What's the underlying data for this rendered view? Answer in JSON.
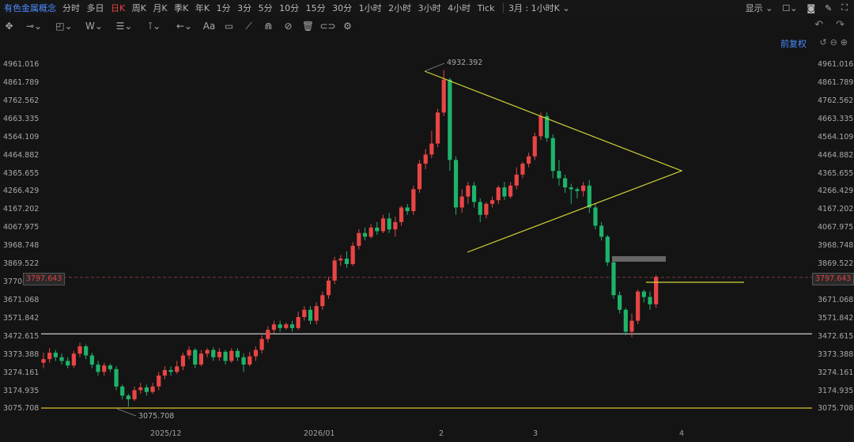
{
  "header": {
    "symbol": "有色金属概念",
    "periods": [
      "分时",
      "多日",
      "日K",
      "周K",
      "月K",
      "季K",
      "年K",
      "1分",
      "3分",
      "5分",
      "10分",
      "15分",
      "30分",
      "1小时",
      "2小时",
      "3小时",
      "4小时",
      "Tick"
    ],
    "active_period": "日K",
    "custom_period": "3月 : 1小时K ⌄",
    "display_label": "显示 ⌄"
  },
  "toolbar": {
    "icons": [
      "move-icon",
      "line-tool-icon",
      "shape-tool-icon",
      "wave-tool-icon",
      "fib-tool-icon",
      "measure-tool-icon",
      "arrow-tool-icon",
      "text-tool-icon",
      "note-tool-icon",
      "brush-icon",
      "magnet-icon",
      "eye-off-icon",
      "trash-icon",
      "link-icon",
      "settings-icon"
    ],
    "text_tool_label": "Aa"
  },
  "adjust": {
    "label": "前复权"
  },
  "axis": {
    "y_ticks": [
      "4961.016",
      "4861.789",
      "4762.562",
      "4663.335",
      "4564.109",
      "4464.882",
      "4365.655",
      "4266.429",
      "4167.202",
      "4067.975",
      "3968.748",
      "3869.522",
      "3770.295",
      "3671.068",
      "3571.842",
      "3472.615",
      "3373.388",
      "3274.161",
      "3174.935",
      "3075.708"
    ],
    "current_price": "3797.643",
    "current_price_left": "3797.643",
    "x_ticks": [
      "2025/12",
      "2026/01",
      "2",
      "3",
      "4"
    ]
  },
  "annotations": {
    "high": "4932.392",
    "low": "3075.708"
  },
  "colors": {
    "up": "#e84545",
    "down": "#1fb36a",
    "triangle": "#d6d63a",
    "support": "#cccccc",
    "bottom": "#c8b030",
    "accent": "#4a8cff"
  },
  "chart_data": {
    "type": "candlestick",
    "ylim": [
      3040,
      5000
    ],
    "high_label": 4932.392,
    "low_label": 3075.708,
    "candles": [
      [
        3330,
        3350,
        3300,
        3385
      ],
      [
        3350,
        3385,
        3330,
        3410
      ],
      [
        3385,
        3360,
        3340,
        3400
      ],
      [
        3360,
        3340,
        3320,
        3380
      ],
      [
        3340,
        3315,
        3300,
        3360
      ],
      [
        3315,
        3380,
        3300,
        3395
      ],
      [
        3380,
        3420,
        3360,
        3440
      ],
      [
        3420,
        3370,
        3350,
        3430
      ],
      [
        3370,
        3320,
        3300,
        3385
      ],
      [
        3320,
        3280,
        3260,
        3340
      ],
      [
        3280,
        3315,
        3260,
        3330
      ],
      [
        3315,
        3295,
        3280,
        3325
      ],
      [
        3295,
        3200,
        3180,
        3310
      ],
      [
        3200,
        3150,
        3130,
        3210
      ],
      [
        3150,
        3130,
        3090,
        3160
      ],
      [
        3130,
        3180,
        3120,
        3200
      ],
      [
        3180,
        3195,
        3160,
        3220
      ],
      [
        3195,
        3170,
        3150,
        3210
      ],
      [
        3170,
        3200,
        3160,
        3220
      ],
      [
        3200,
        3260,
        3180,
        3280
      ],
      [
        3260,
        3290,
        3240,
        3310
      ],
      [
        3290,
        3280,
        3260,
        3310
      ],
      [
        3280,
        3310,
        3270,
        3340
      ],
      [
        3310,
        3370,
        3290,
        3385
      ],
      [
        3370,
        3400,
        3350,
        3420
      ],
      [
        3400,
        3320,
        3300,
        3410
      ],
      [
        3320,
        3380,
        3310,
        3400
      ],
      [
        3380,
        3400,
        3360,
        3410
      ],
      [
        3400,
        3360,
        3340,
        3415
      ],
      [
        3360,
        3390,
        3340,
        3410
      ],
      [
        3390,
        3340,
        3320,
        3400
      ],
      [
        3340,
        3395,
        3330,
        3410
      ],
      [
        3395,
        3360,
        3340,
        3410
      ],
      [
        3360,
        3320,
        3280,
        3380
      ],
      [
        3320,
        3365,
        3310,
        3390
      ],
      [
        3365,
        3400,
        3340,
        3420
      ],
      [
        3400,
        3460,
        3380,
        3480
      ],
      [
        3460,
        3510,
        3440,
        3530
      ],
      [
        3510,
        3540,
        3490,
        3560
      ],
      [
        3540,
        3520,
        3500,
        3560
      ],
      [
        3520,
        3540,
        3510,
        3550
      ],
      [
        3540,
        3520,
        3500,
        3560
      ],
      [
        3520,
        3580,
        3510,
        3610
      ],
      [
        3580,
        3620,
        3560,
        3640
      ],
      [
        3620,
        3560,
        3540,
        3640
      ],
      [
        3560,
        3640,
        3540,
        3660
      ],
      [
        3640,
        3700,
        3620,
        3720
      ],
      [
        3700,
        3780,
        3680,
        3800
      ],
      [
        3780,
        3890,
        3760,
        3910
      ],
      [
        3890,
        3900,
        3860,
        3920
      ],
      [
        3900,
        3870,
        3850,
        3940
      ],
      [
        3870,
        3970,
        3860,
        3990
      ],
      [
        3970,
        4040,
        3950,
        4060
      ],
      [
        4040,
        4020,
        4000,
        4070
      ],
      [
        4020,
        4070,
        4010,
        4090
      ],
      [
        4070,
        4050,
        4030,
        4100
      ],
      [
        4050,
        4120,
        4040,
        4140
      ],
      [
        4120,
        4060,
        4040,
        4150
      ],
      [
        4060,
        4100,
        4020,
        4130
      ],
      [
        4100,
        4180,
        4080,
        4190
      ],
      [
        4180,
        4160,
        4140,
        4200
      ],
      [
        4160,
        4280,
        4140,
        4300
      ],
      [
        4280,
        4420,
        4260,
        4440
      ],
      [
        4420,
        4470,
        4390,
        4500
      ],
      [
        4470,
        4530,
        4450,
        4600
      ],
      [
        4530,
        4700,
        4510,
        4720
      ],
      [
        4700,
        4880,
        4680,
        4932
      ],
      [
        4880,
        4440,
        4380,
        4890
      ],
      [
        4440,
        4180,
        4140,
        4460
      ],
      [
        4180,
        4240,
        4150,
        4280
      ],
      [
        4240,
        4300,
        4200,
        4320
      ],
      [
        4300,
        4210,
        4180,
        4320
      ],
      [
        4210,
        4140,
        4100,
        4230
      ],
      [
        4140,
        4200,
        4120,
        4210
      ],
      [
        4200,
        4220,
        4180,
        4240
      ],
      [
        4220,
        4290,
        4200,
        4300
      ],
      [
        4290,
        4240,
        4220,
        4320
      ],
      [
        4240,
        4300,
        4230,
        4320
      ],
      [
        4300,
        4360,
        4280,
        4400
      ],
      [
        4360,
        4420,
        4340,
        4430
      ],
      [
        4420,
        4460,
        4400,
        4480
      ],
      [
        4460,
        4570,
        4440,
        4590
      ],
      [
        4570,
        4680,
        4550,
        4700
      ],
      [
        4680,
        4560,
        4540,
        4700
      ],
      [
        4560,
        4380,
        4340,
        4580
      ],
      [
        4380,
        4340,
        4300,
        4440
      ],
      [
        4340,
        4290,
        4260,
        4360
      ],
      [
        4290,
        4280,
        4200,
        4310
      ],
      [
        4280,
        4270,
        4230,
        4290
      ],
      [
        4270,
        4300,
        4240,
        4320
      ],
      [
        4300,
        4180,
        4150,
        4330
      ],
      [
        4180,
        4080,
        4060,
        4200
      ],
      [
        4080,
        4020,
        4000,
        4100
      ],
      [
        4020,
        3880,
        3860,
        4030
      ],
      [
        3880,
        3700,
        3680,
        3890
      ],
      [
        3700,
        3620,
        3600,
        3720
      ],
      [
        3620,
        3500,
        3480,
        3630
      ],
      [
        3500,
        3560,
        3470,
        3600
      ],
      [
        3560,
        3720,
        3540,
        3730
      ],
      [
        3720,
        3690,
        3660,
        3730
      ],
      [
        3690,
        3650,
        3620,
        3720
      ],
      [
        3650,
        3800,
        3630,
        3810
      ]
    ]
  }
}
